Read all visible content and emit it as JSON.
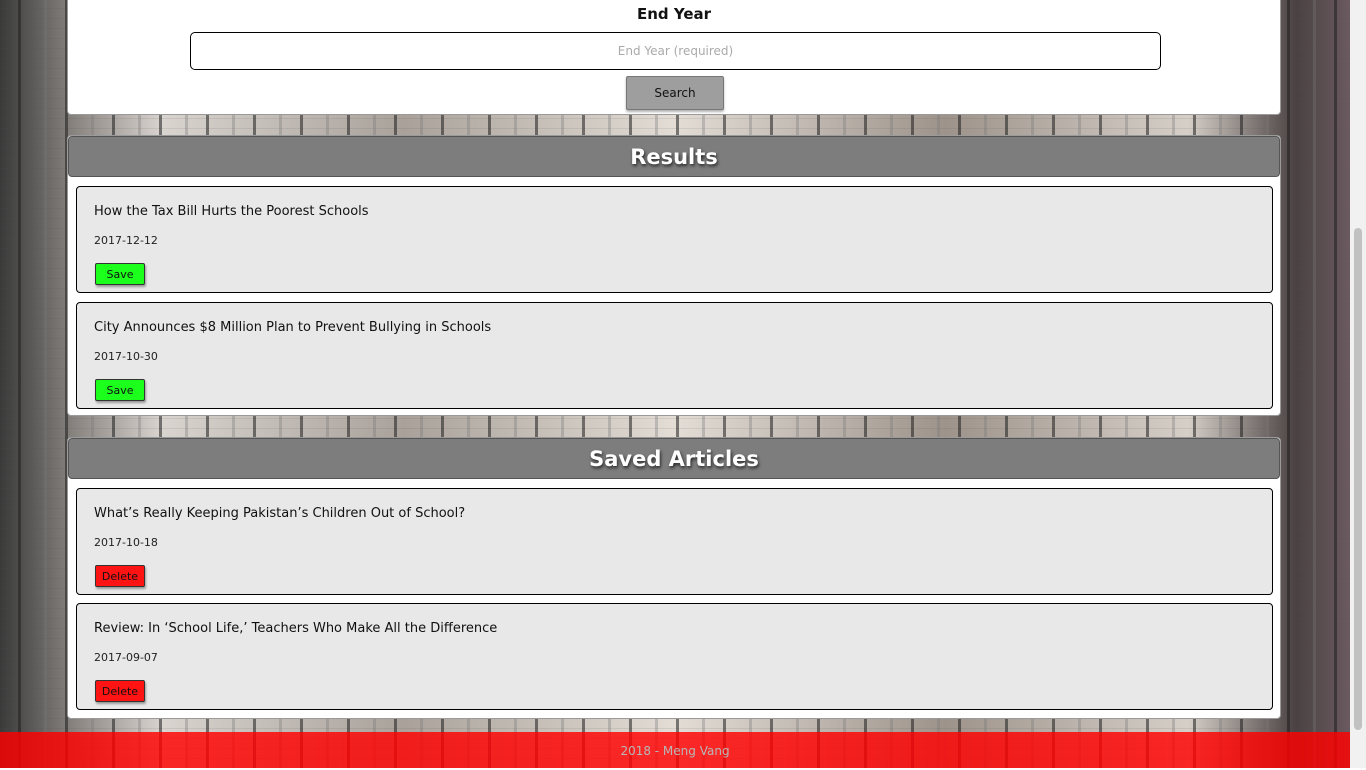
{
  "search": {
    "end_year_label": "End Year",
    "end_year_value": "",
    "end_year_placeholder": "End Year (required)",
    "search_button_label": "Search"
  },
  "results": {
    "heading": "Results",
    "articles": [
      {
        "title": "How the Tax Bill Hurts the Poorest Schools",
        "date": "2017-12-12",
        "button_label": "Save"
      },
      {
        "title": "City Announces $8 Million Plan to Prevent Bullying in Schools",
        "date": "2017-10-30",
        "button_label": "Save"
      }
    ]
  },
  "saved": {
    "heading": "Saved Articles",
    "articles": [
      {
        "title": "What’s Really Keeping Pakistan’s Children Out of School?",
        "date": "2017-10-18",
        "button_label": "Delete"
      },
      {
        "title": "Review: In ‘School Life,’ Teachers Who Make All the Difference",
        "date": "2017-09-07",
        "button_label": "Delete"
      }
    ]
  },
  "footer": {
    "text": "2018 - Meng Vang"
  },
  "colors": {
    "save_button": "#1cff1c",
    "delete_button": "#ff1313",
    "panel_heading": "#7d7d7d",
    "footer": "#ff0000"
  }
}
